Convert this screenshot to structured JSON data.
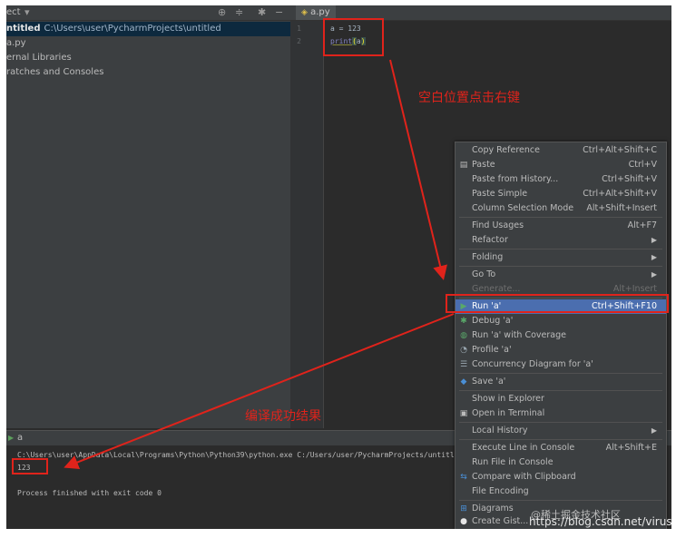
{
  "project_panel": {
    "header_label": "ect",
    "root_name": "ntitled",
    "root_path": "C:\\Users\\user\\PycharmProjects\\untitled",
    "items": [
      "a.py",
      "ernal Libraries",
      "ratches and Consoles"
    ]
  },
  "editor": {
    "tab": "a.py",
    "lines": [
      {
        "num": "1",
        "code": "a = 123"
      },
      {
        "num": "2",
        "code_fn": "print",
        "code_arg": "a"
      }
    ]
  },
  "run_panel": {
    "tab": "a",
    "command": "C:\\Users\\user\\AppData\\Local\\Programs\\Python\\Python39\\python.exe C:/Users/user/PycharmProjects/untitled/a.p",
    "output": "123",
    "exit": "Process finished with exit code 0"
  },
  "context_menu": {
    "items": [
      {
        "label": "Copy Reference",
        "shortcut": "Ctrl+Alt+Shift+C"
      },
      {
        "label": "Paste",
        "shortcut": "Ctrl+V",
        "icon": "▤"
      },
      {
        "label": "Paste from History...",
        "shortcut": "Ctrl+Shift+V"
      },
      {
        "label": "Paste Simple",
        "shortcut": "Ctrl+Alt+Shift+V"
      },
      {
        "label": "Column Selection Mode",
        "shortcut": "Alt+Shift+Insert"
      },
      {
        "label": "Find Usages",
        "shortcut": "Alt+F7"
      },
      {
        "label": "Refactor",
        "arrow": "▶"
      },
      {
        "label": "Folding",
        "arrow": "▶"
      },
      {
        "label": "Go To",
        "arrow": "▶"
      },
      {
        "label": "Generate...",
        "shortcut": "Alt+Insert"
      },
      {
        "label": "Run 'a'",
        "shortcut": "Ctrl+Shift+F10",
        "icon": "▶"
      },
      {
        "label": "Debug 'a'",
        "icon": "✱"
      },
      {
        "label": "Run 'a' with Coverage",
        "icon": "◍"
      },
      {
        "label": "Profile 'a'",
        "icon": "◔"
      },
      {
        "label": "Concurrency Diagram for 'a'",
        "icon": "☰"
      },
      {
        "label": "Save 'a'",
        "icon": "◆"
      },
      {
        "label": "Show in Explorer"
      },
      {
        "label": "Open in Terminal",
        "icon": "▣"
      },
      {
        "label": "Local History",
        "arrow": "▶"
      },
      {
        "label": "Execute Line in Console",
        "shortcut": "Alt+Shift+E"
      },
      {
        "label": "Run File in Console"
      },
      {
        "label": "Compare with Clipboard",
        "icon": "⇆"
      },
      {
        "label": "File Encoding"
      },
      {
        "label": "Diagrams",
        "icon": "⊞"
      },
      {
        "label": "Create Gist...",
        "icon": "●"
      }
    ]
  },
  "annotations": {
    "right_click_note": "空白位置点击右键",
    "result_note": "编译成功结果"
  },
  "watermark": {
    "line1": "@稀土掘金技术社区",
    "line2": "https://blog.csdn.net/virusss"
  },
  "colors": {
    "accent": "#4b6eaf",
    "annotation": "#e0231b"
  }
}
